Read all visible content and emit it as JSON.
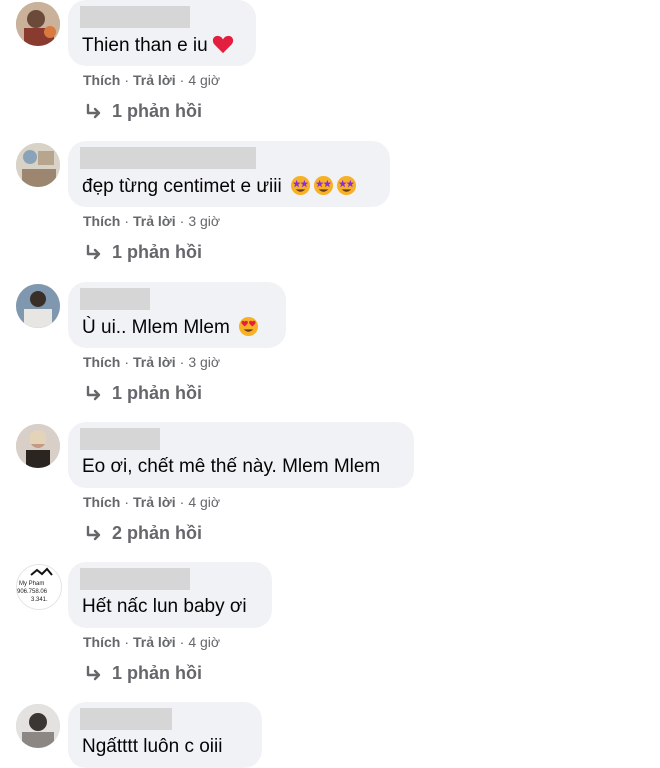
{
  "comments": [
    {
      "text": "Thien than e iu",
      "like": "Thích",
      "reply": "Trả lời",
      "time": "4 giờ",
      "replies": "1 phản hồi"
    },
    {
      "text": "đẹp từng centimet e ưiii",
      "like": "Thích",
      "reply": "Trả lời",
      "time": "3 giờ",
      "replies": "1 phản hồi"
    },
    {
      "text": "Ù ui.. Mlem Mlem",
      "like": "Thích",
      "reply": "Trả lời",
      "time": "3 giờ",
      "replies": "1 phản hồi"
    },
    {
      "text": "Eo ơi, chết mê thế này. Mlem Mlem",
      "like": "Thích",
      "reply": "Trả lời",
      "time": "4 giờ",
      "replies": "2 phản hồi"
    },
    {
      "text": "Hết nấc lun baby ơi",
      "like": "Thích",
      "reply": "Trả lời",
      "time": "4 giờ",
      "replies": "1 phản hồi"
    },
    {
      "text": "Ngấtttt luôn c oiii"
    }
  ],
  "avatar_logo": {
    "line1": "My Pham",
    "line2": "906.758.06",
    "line3": "3.341."
  },
  "icons": {
    "heart": "heart-icon",
    "star_eyes": "star-struck-emoji-icon",
    "heart_eyes": "heart-eyes-emoji-icon",
    "reply_arrow": "reply-arrow-icon"
  },
  "colors": {
    "bubble": "#f0f2f5",
    "meta_text": "#65676b",
    "heart": "#e41e3f",
    "emoji": "#f7b125"
  }
}
